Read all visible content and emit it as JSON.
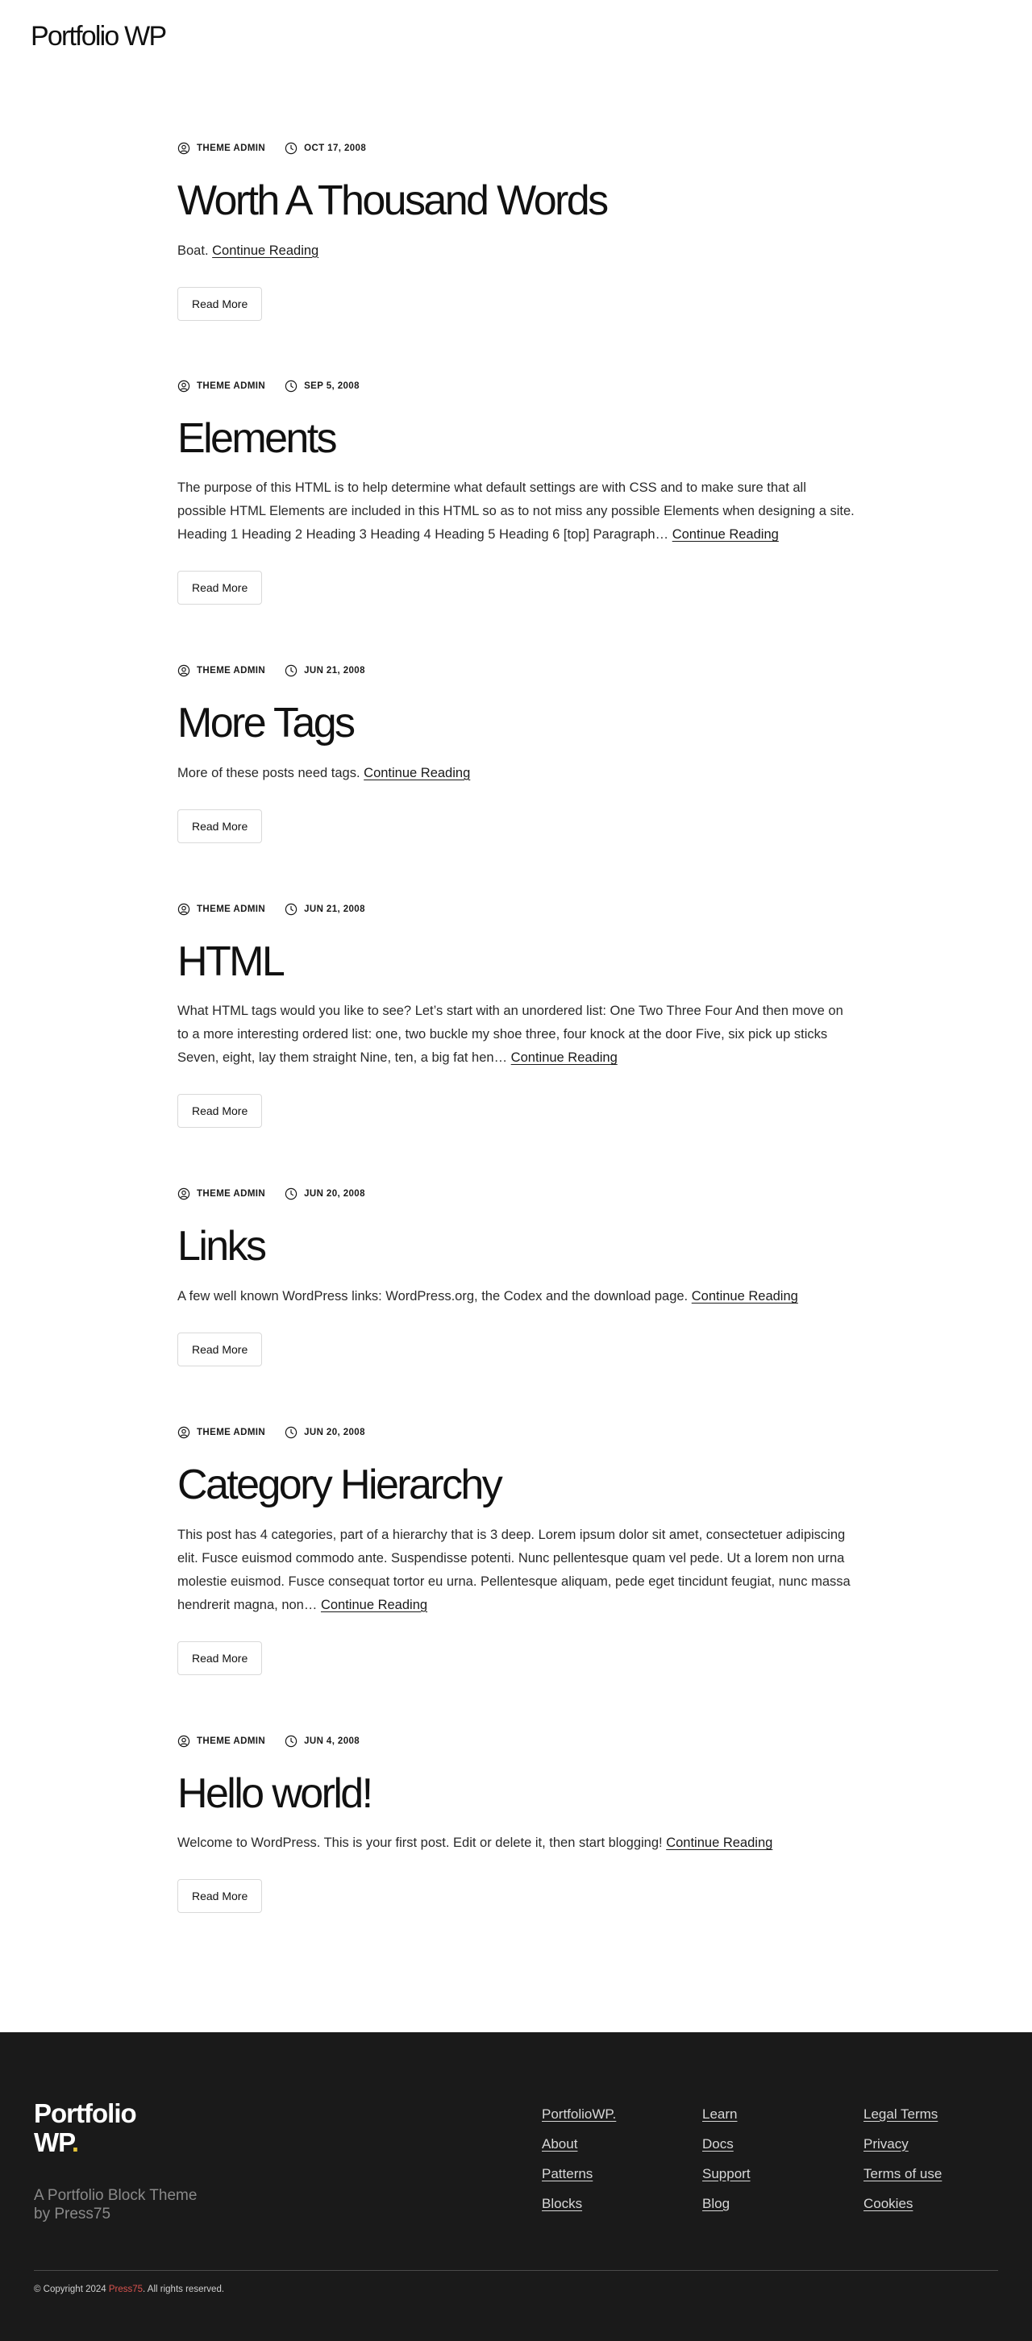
{
  "header": {
    "site_title": "Portfolio WP"
  },
  "posts": [
    {
      "author": "THEME ADMIN",
      "date": "OCT 17, 2008",
      "title": "Worth A Thousand Words",
      "excerpt": "Boat.",
      "continue_label": "Continue Reading",
      "read_more_label": "Read More"
    },
    {
      "author": "THEME ADMIN",
      "date": "SEP 5, 2008",
      "title": "Elements",
      "excerpt": "The purpose of this HTML is to help determine what default settings are with CSS and to make sure that all possible HTML Elements are included in this HTML so as to not miss any possible Elements when designing a site. Heading 1 Heading 2 Heading 3 Heading 4 Heading 5 Heading 6 [top] Paragraph…",
      "continue_label": "Continue Reading",
      "read_more_label": "Read More"
    },
    {
      "author": "THEME ADMIN",
      "date": "JUN 21, 2008",
      "title": "More Tags",
      "excerpt": "More of these posts need tags.",
      "continue_label": "Continue Reading",
      "read_more_label": "Read More"
    },
    {
      "author": "THEME ADMIN",
      "date": "JUN 21, 2008",
      "title": "HTML",
      "excerpt": "What HTML tags would you like to see? Let’s start with an unordered list: One Two Three Four And then move on to a more interesting ordered list: one, two buckle my shoe three, four knock at the door Five, six pick up sticks Seven, eight, lay them straight Nine, ten, a big fat hen…",
      "continue_label": "Continue Reading",
      "read_more_label": "Read More"
    },
    {
      "author": "THEME ADMIN",
      "date": "JUN 20, 2008",
      "title": "Links",
      "excerpt": "A few well known WordPress links: WordPress.org, the Codex and the download page.",
      "continue_label": "Continue Reading",
      "read_more_label": "Read More"
    },
    {
      "author": "THEME ADMIN",
      "date": "JUN 20, 2008",
      "title": "Category Hierarchy",
      "excerpt": "This post has 4 categories, part of a hierarchy that is 3 deep. Lorem ipsum dolor sit amet, consectetuer adipiscing elit. Fusce euismod commodo ante. Suspendisse potenti. Nunc pellentesque quam vel pede. Ut a lorem non urna molestie euismod. Fusce consequat tortor eu urna. Pellentesque aliquam, pede eget tincidunt feugiat, nunc massa hendrerit magna, non…",
      "continue_label": "Continue Reading",
      "read_more_label": "Read More"
    },
    {
      "author": "THEME ADMIN",
      "date": "JUN 4, 2008",
      "title": "Hello world!",
      "excerpt": "Welcome to WordPress. This is your first post. Edit or delete it, then start blogging!",
      "continue_label": "Continue Reading",
      "read_more_label": "Read More"
    }
  ],
  "icons": {
    "author": "user-circle-icon",
    "date": "clock-icon"
  },
  "footer": {
    "logo_line1": "Portfolio",
    "logo_line2": "WP",
    "logo_dot": ".",
    "tagline_line1": "A Portfolio Block Theme",
    "tagline_line2": "by Press75",
    "columns": [
      [
        "PortfolioWP.",
        "About",
        "Patterns",
        "Blocks"
      ],
      [
        "Learn",
        "Docs",
        "Support",
        "Blog"
      ],
      [
        "Legal Terms",
        "Privacy",
        "Terms of use",
        "Cookies"
      ]
    ],
    "copyright_prefix": "© Copyright 2024 ",
    "copyright_link": "Press75",
    "copyright_suffix": ". All rights reserved."
  },
  "colors": {
    "footer_bg": "#1a1a1a",
    "logo_dot": "#e5c53a",
    "press75_link": "#d9534f"
  }
}
